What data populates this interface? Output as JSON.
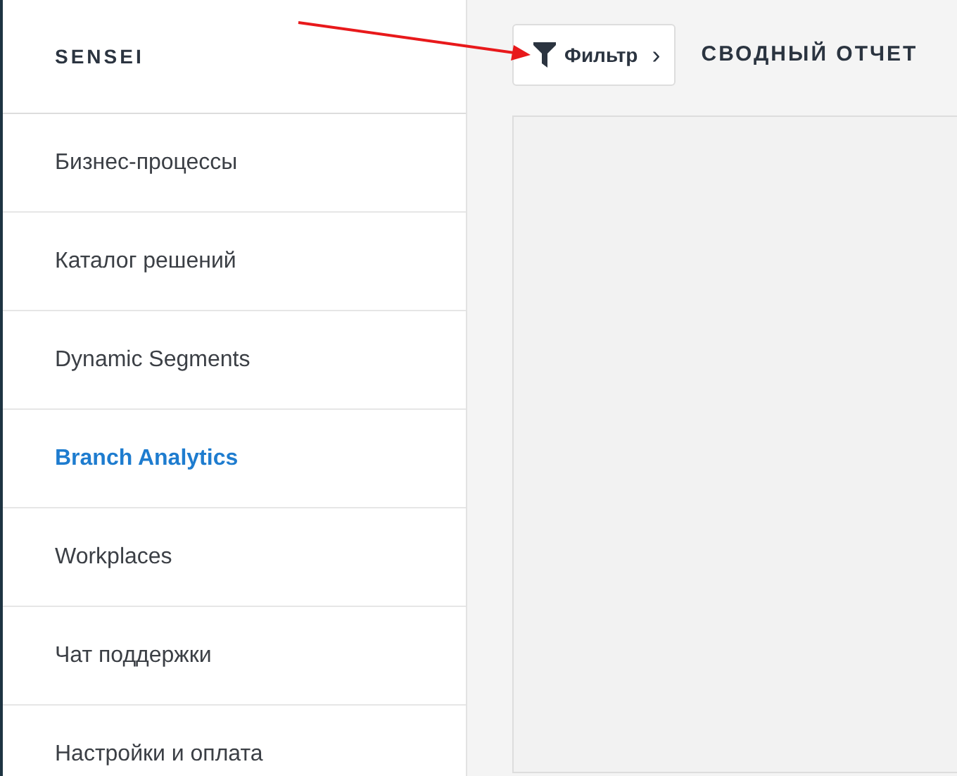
{
  "sidebar": {
    "brand": "SENSEI",
    "items": [
      {
        "label": "Бизнес-процессы",
        "selected": false
      },
      {
        "label": "Каталог решений",
        "selected": false
      },
      {
        "label": "Dynamic Segments",
        "selected": false
      },
      {
        "label": "Branch Analytics",
        "selected": true
      },
      {
        "label": "Workplaces",
        "selected": false
      },
      {
        "label": "Чат поддержки",
        "selected": false
      },
      {
        "label": "Настройки и оплата",
        "selected": false
      }
    ]
  },
  "toolbar": {
    "filter_button": "Фильтр",
    "chevron": "›",
    "title": "СВОДНЫЙ ОТЧЕТ"
  },
  "annotation": {
    "kind": "arrow"
  }
}
